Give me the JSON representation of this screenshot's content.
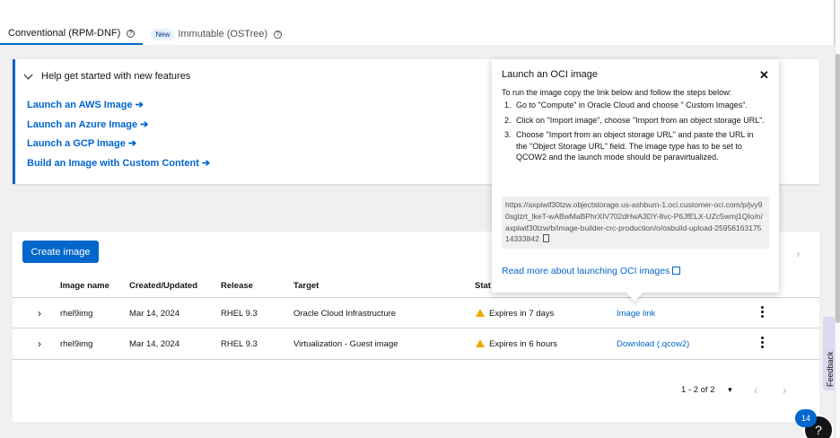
{
  "tabs": [
    {
      "label": "Conventional (RPM-DNF)",
      "active": true
    },
    {
      "label": "Immutable (OSTree)",
      "badge": "New",
      "active": false
    }
  ],
  "help": {
    "heading": "Help get started with new features",
    "links": [
      "Launch an AWS Image",
      "Launch an Azure Image",
      "Launch a GCP Image",
      "Build an Image with Custom Content"
    ]
  },
  "toolbar": {
    "create_label": "Create image"
  },
  "table": {
    "headers": [
      "Image name",
      "Created/Updated",
      "Release",
      "Target",
      "Stat"
    ],
    "rows": [
      {
        "name": "rhel9img",
        "created": "Mar 14, 2024",
        "release": "RHEL 9.3",
        "target": "Oracle Cloud Infrastructure",
        "status": "Expires in 7 days",
        "action": "Image link"
      },
      {
        "name": "rhel9img",
        "created": "Mar 14, 2024",
        "release": "RHEL 9.3",
        "target": "Virtualization - Guest image",
        "status": "Expires in 6 hours",
        "action": "Download (.qcow2)"
      }
    ]
  },
  "pagination": {
    "range": "1 - 2 of 2"
  },
  "popover": {
    "title": "Launch an OCI image",
    "intro": "To run the image copy the link below and follow the steps below:",
    "steps": [
      "Go to \"Compute\" in Oracle Cloud and choose \" Custom Images\".",
      "Click on \"Import image\", choose \"Import from an object storage URL\".",
      "Choose \"Import from an object storage URL\" and paste the URL in the \"Object Storage URL\" field. The image type has to be set to QCOW2 and the launch mode should be paravirtualized."
    ],
    "url": "https://axpiwif30tzw.objectstorage.us-ashburn-1.oci.customer-oci.com/p/jvy90sglzrt_lkeT-wABwMaBPhrXIV702dHwA3DY-8vc-P6JfELX-UZc5wmj1QIo/n/axpiwif30tzw/b/image-builder-crc-production/o/osbuild-upload-2595616317514333842",
    "read_more": "Read more about launching OCI images"
  },
  "feedback_label": "Feedback",
  "notification_count": "14",
  "colors": {
    "accent": "#0066cc",
    "warning": "#f0ab00"
  }
}
